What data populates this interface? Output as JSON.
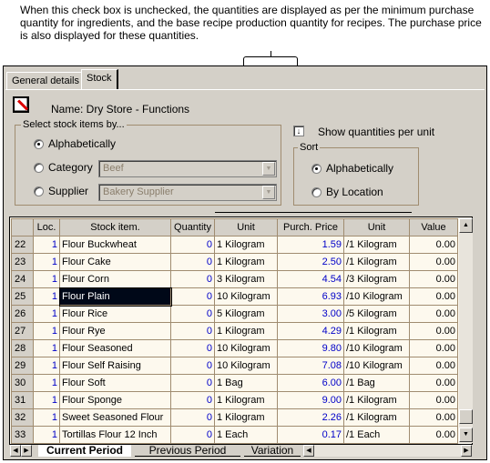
{
  "callout": {
    "text": "When this check box is unchecked, the quantities are displayed as per the minimum purchase quantity for ingredients, and the base recipe production quantity for recipes. The purchase price is also displayed for these quantities."
  },
  "tabs": [
    {
      "label": "General details",
      "active": false
    },
    {
      "label": "Stock",
      "active": true
    }
  ],
  "name_label": "Name: Dry Store - Functions",
  "select_group": {
    "title": "Select stock items by...",
    "options": [
      {
        "label": "Alphabetically",
        "selected": true
      },
      {
        "label": "Category",
        "selected": false,
        "combo": "Beef"
      },
      {
        "label": "Supplier",
        "selected": false,
        "combo": "Bakery Supplier"
      }
    ]
  },
  "show_qty": {
    "label": "Show quantities per unit",
    "checked": true
  },
  "sort_group": {
    "title": "Sort",
    "options": [
      {
        "label": "Alphabetically",
        "selected": true
      },
      {
        "label": "By Location",
        "selected": false
      }
    ]
  },
  "grid": {
    "headers": [
      "",
      "Loc.",
      "Stock item.",
      "Quantity",
      "Unit",
      "Purch. Price",
      "Unit",
      "Value"
    ],
    "rows": [
      [
        "22",
        "1",
        "Flour Buckwheat",
        "0",
        "1 Kilogram",
        "1.59",
        "/1 Kilogram",
        "0.00"
      ],
      [
        "23",
        "1",
        "Flour Cake",
        "0",
        "1 Kilogram",
        "2.50",
        "/1 Kilogram",
        "0.00"
      ],
      [
        "24",
        "1",
        "Flour Corn",
        "0",
        "3 Kilogram",
        "4.54",
        "/3 Kilogram",
        "0.00"
      ],
      [
        "25",
        "1",
        "Flour Plain",
        "0",
        "10 Kilogram",
        "6.93",
        "/10 Kilogram",
        "0.00"
      ],
      [
        "26",
        "1",
        "Flour Rice",
        "0",
        "5 Kilogram",
        "3.00",
        "/5 Kilogram",
        "0.00"
      ],
      [
        "27",
        "1",
        "Flour Rye",
        "0",
        "1 Kilogram",
        "4.29",
        "/1 Kilogram",
        "0.00"
      ],
      [
        "28",
        "1",
        "Flour Seasoned",
        "0",
        "10 Kilogram",
        "9.80",
        "/10 Kilogram",
        "0.00"
      ],
      [
        "29",
        "1",
        "Flour Self Raising",
        "0",
        "10 Kilogram",
        "7.08",
        "/10 Kilogram",
        "0.00"
      ],
      [
        "30",
        "1",
        "Flour Soft",
        "0",
        "1 Bag",
        "6.00",
        "/1 Bag",
        "0.00"
      ],
      [
        "31",
        "1",
        "Flour Sponge",
        "0",
        "1 Kilogram",
        "9.00",
        "/1 Kilogram",
        "0.00"
      ],
      [
        "32",
        "1",
        "Sweet Seasoned Flour",
        "0",
        "1 Kilogram",
        "2.26",
        "/1 Kilogram",
        "0.00"
      ],
      [
        "33",
        "1",
        "Tortillas Flour 12 Inch",
        "0",
        "1 Each",
        "0.17",
        "/1 Each",
        "0.00"
      ]
    ],
    "selected_row": 3
  },
  "sheet_tabs": [
    {
      "label": "Current Period",
      "active": true
    },
    {
      "label": "Previous Period",
      "active": false
    },
    {
      "label": "Variation",
      "active": false
    }
  ]
}
